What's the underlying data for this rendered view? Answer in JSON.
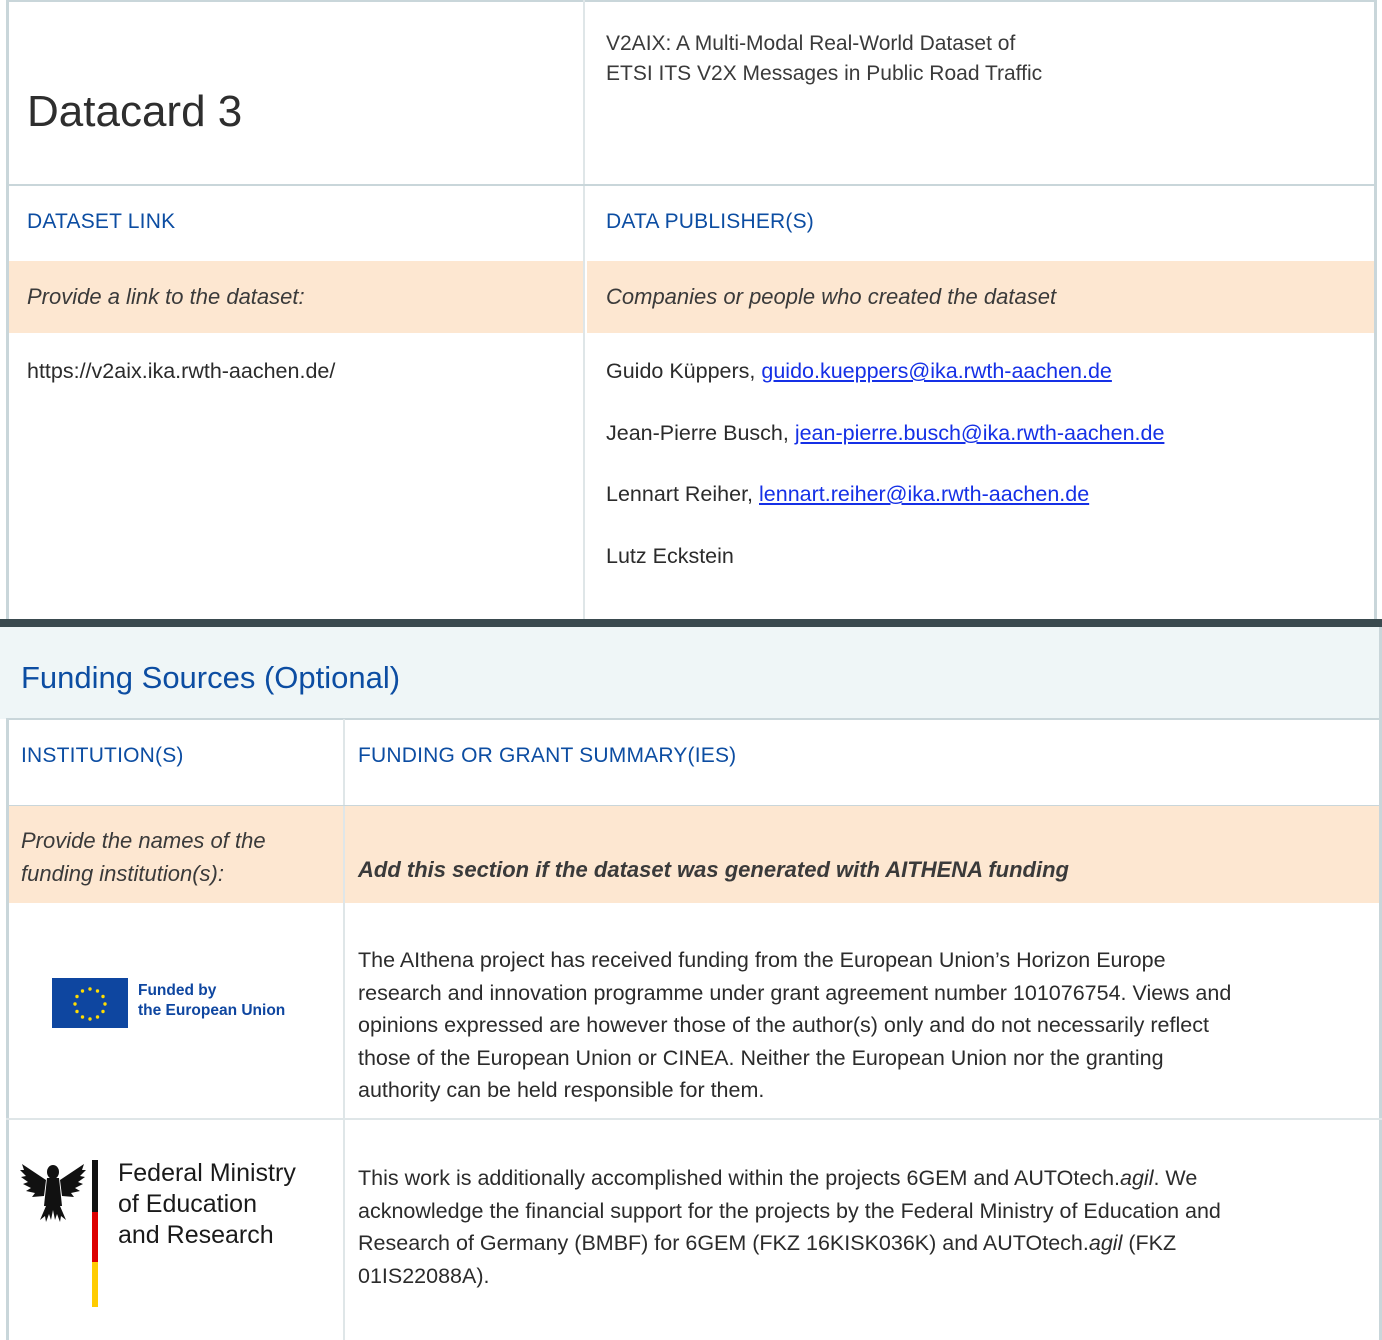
{
  "header": {
    "title": "Datacard 3",
    "subtitle_line1": "V2AIX: A Multi-Modal Real-World Dataset of",
    "subtitle_line2": "ETSI ITS V2X Messages in Public Road Traffic"
  },
  "dataset": {
    "link_label": "DATASET LINK",
    "publishers_label": "DATA PUBLISHER(S)",
    "link_prompt": "Provide a link to the dataset:",
    "publishers_prompt": "Companies or people who created the dataset",
    "link_value": "https://v2aix.ika.rwth-aachen.de/",
    "publishers": [
      {
        "name": "Guido Küppers, ",
        "email": "guido.kueppers@ika.rwth-aachen.de"
      },
      {
        "name": "Jean-Pierre Busch, ",
        "email": "jean-pierre.busch@ika.rwth-aachen.de"
      },
      {
        "name": "Lennart Reiher, ",
        "email": "lennart.reiher@ika.rwth-aachen.de"
      },
      {
        "name": "Lutz Eckstein",
        "email": ""
      }
    ]
  },
  "funding": {
    "section_title": "Funding Sources (Optional)",
    "institutions_label": "INSTITUTION(S)",
    "summary_label": "FUNDING OR GRANT SUMMARY(IES)",
    "institutions_prompt_line1": "Provide the names of the",
    "institutions_prompt_line2": "funding institution(s):",
    "summary_prompt": "Add this section if the dataset was generated with AITHENA funding",
    "eu": {
      "logo_line1": "Funded by",
      "logo_line2": "the European Union",
      "text_lines": [
        "The AIthena project has received funding from the European Union’s Horizon Europe",
        "research and innovation programme under grant agreement number 101076754. Views and",
        "opinions expressed are however those of the author(s) only and do not necessarily reflect",
        "those of the European Union or CINEA. Neither the European Union nor the granting",
        "authority can be held responsible for them."
      ]
    },
    "bmbf": {
      "logo_line1": "Federal Ministry",
      "logo_line2": "of Education",
      "logo_line3": "and Research",
      "line1_a": "This work is additionally accomplished within the projects 6GEM and AUTOtech.",
      "line1_b": "agil",
      "line1_c": ". We",
      "line2": "acknowledge the financial support for the projects by the Federal Ministry of Education and",
      "line3_a": "Research of Germany (BMBF) for 6GEM (FKZ 16KISK036K) and AUTOtech.",
      "line3_b": "agil",
      "line3_c": " (FKZ",
      "line4": "01IS22088A)."
    }
  },
  "colors": {
    "accent_blue": "#0c4da2",
    "link_blue": "#1530e6",
    "prompt_bg": "#fde7d1",
    "section_band_bg": "#eff6f7",
    "divider_dark": "#3a4a4f"
  }
}
